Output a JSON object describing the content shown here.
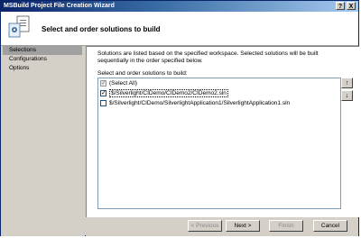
{
  "window": {
    "title": "MSBuild Project File Creation Wizard",
    "help_glyph": "?",
    "close_glyph": "X"
  },
  "header": {
    "title": "Select and order solutions to build"
  },
  "nav": {
    "items": [
      {
        "label": "Selections",
        "selected": true
      },
      {
        "label": "Configurations",
        "selected": false
      },
      {
        "label": "Options",
        "selected": false
      }
    ]
  },
  "content": {
    "description": "Solutions are listed based on the specified workspace. Selected solutions will be built sequentially in the order specified below.",
    "list_label": "Select and order solutions to build:",
    "select_all_label": "(Select All)",
    "solutions": [
      {
        "path": "$/Silverlight/CIDemo/CIDemo2/CIDemo2.sln",
        "checked": true
      },
      {
        "path": "$/Silverlight/CIDemo/SilverlightApplication1/SilverlightApplication1.sln",
        "checked": false
      }
    ],
    "move_up_glyph": "↑",
    "move_down_glyph": "↓"
  },
  "footer": {
    "previous_label": "< Previous",
    "next_label": "Next >",
    "finish_label": "Finish",
    "cancel_label": "Cancel"
  },
  "check_glyph": "✓",
  "colors": {
    "title_bar": "#0a246a",
    "window_face": "#d4d0c8",
    "nav_selected": "#a0a0a0"
  }
}
